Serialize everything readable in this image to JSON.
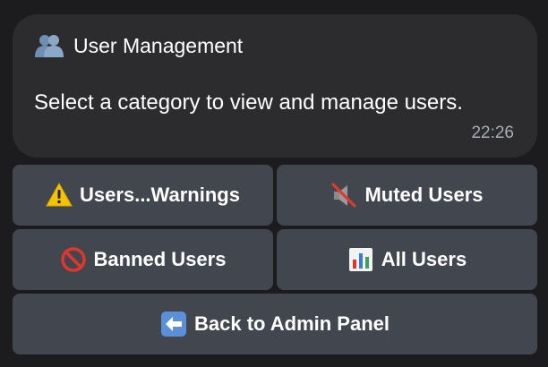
{
  "message": {
    "title_icon": "busts-in-silhouette-icon",
    "title": "User Management",
    "body": "Select a category to view and manage users.",
    "time": "22:26"
  },
  "keyboard": {
    "rows": [
      [
        {
          "icon": "warning-icon",
          "label": "Users...Warnings"
        },
        {
          "icon": "muted-speaker-icon",
          "label": "Muted Users"
        }
      ],
      [
        {
          "icon": "prohibited-icon",
          "label": "Banned Users"
        },
        {
          "icon": "bar-chart-icon",
          "label": "All Users"
        }
      ],
      [
        {
          "icon": "left-arrow-icon",
          "label": "Back to Admin Panel"
        }
      ]
    ]
  }
}
